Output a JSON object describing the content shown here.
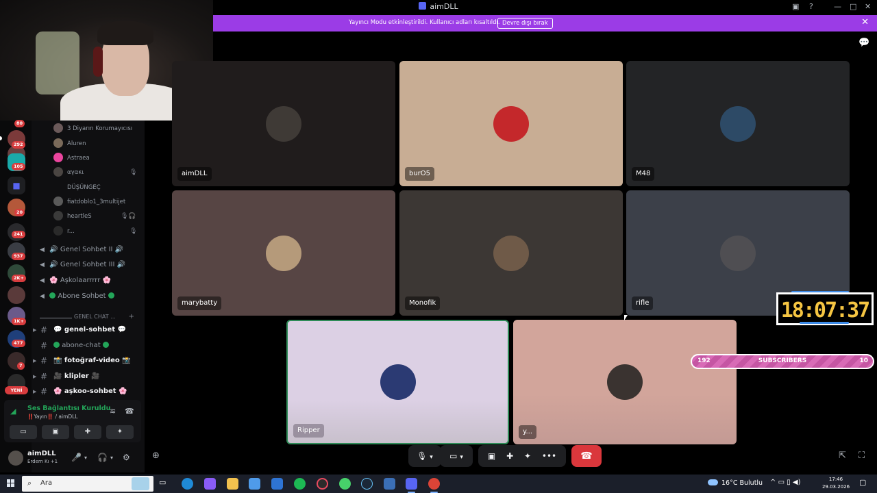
{
  "window": {
    "title": "aimDLL"
  },
  "banner": {
    "text": "Yayıncı Modu etkinleştirildi. Kullanıcı adları kısaltıldı.",
    "button": "Devre dışı bırak"
  },
  "servers": [
    {
      "badge": "80"
    },
    {
      "badge": "292"
    },
    {
      "badge": "105"
    },
    {
      "badge": ""
    },
    {
      "badge": "20"
    },
    {
      "badge": "241"
    },
    {
      "badge": "937"
    },
    {
      "badge": "2K+"
    },
    {
      "badge": ""
    },
    {
      "badge": "1K+"
    },
    {
      "badge": "477"
    },
    {
      "badge": "7"
    }
  ],
  "new_label": "YENİ",
  "voice_users": [
    {
      "name": "3 Diyarın Korumayıcısı",
      "icons": ""
    },
    {
      "name": "Aluren",
      "icons": ""
    },
    {
      "name": "Astraea",
      "icons": ""
    },
    {
      "name": "αγακι",
      "icons": "🎙"
    },
    {
      "name": "DÜŞÜNGEÇ",
      "icons": ""
    },
    {
      "name": "fiatdoblo1_3multijet",
      "icons": ""
    },
    {
      "name": "heartleS",
      "icons": "🎙🎧"
    },
    {
      "name": "r...",
      "icons": "🎙"
    }
  ],
  "voice_channels": [
    {
      "name": "🔊 Genel Sohbet II 🔊"
    },
    {
      "name": "🔊 Genel Sohbet III 🔊"
    },
    {
      "name": "🌸 Aşkolaarrrrr 🌸"
    },
    {
      "name": "Abone Sohbet"
    }
  ],
  "category": {
    "label": "GENEL CHAT ..."
  },
  "text_channels": [
    {
      "name": "💬 genel-sohbet 💬"
    },
    {
      "name": "abone-chat"
    },
    {
      "name": "📸 fotoğraf-video 📸"
    },
    {
      "name": "🎥 klipler 🎥"
    },
    {
      "name": "🌸 aşkoo-sohbet 🌸"
    }
  ],
  "voice_panel": {
    "status": "Ses Bağlantısı Kuruldu",
    "sub": "‼️Yayın‼️ / aimDLL"
  },
  "user_panel": {
    "name": "aimDLL",
    "sub": "Erdem Kı +1"
  },
  "tiles": [
    {
      "name": "aimDLL"
    },
    {
      "name": "burO5"
    },
    {
      "name": "M48"
    },
    {
      "name": "marybatty"
    },
    {
      "name": "Monofik"
    },
    {
      "name": "rifle"
    },
    {
      "name": "Ripper"
    },
    {
      "name": "y..."
    }
  ],
  "overlays": {
    "clock": "18:07:37",
    "subs_left": "192",
    "subs_label": "SUBSCRIBERS",
    "subs_right": "10"
  },
  "taskbar": {
    "search": "Ara",
    "weather": "16°C Bulutlu",
    "time": "17:46",
    "date": "29.03.2026"
  },
  "colors": {
    "accent": "#5865f2",
    "banner": "#9b3ce6",
    "hangup": "#da373c",
    "voice_green": "#23a559",
    "clock": "#f5c542"
  },
  "icons": {
    "voice_panel": [
      "signal-icon",
      "noise-icon",
      "disconnect-icon",
      "camera-off-icon",
      "screen-share-icon",
      "activities-icon",
      "soundboard-icon"
    ],
    "controls": [
      "mic-icon",
      "camera-off-icon",
      "screen-share-icon",
      "activities-icon",
      "soundboard-icon",
      "more-icon",
      "hangup-icon"
    ]
  }
}
